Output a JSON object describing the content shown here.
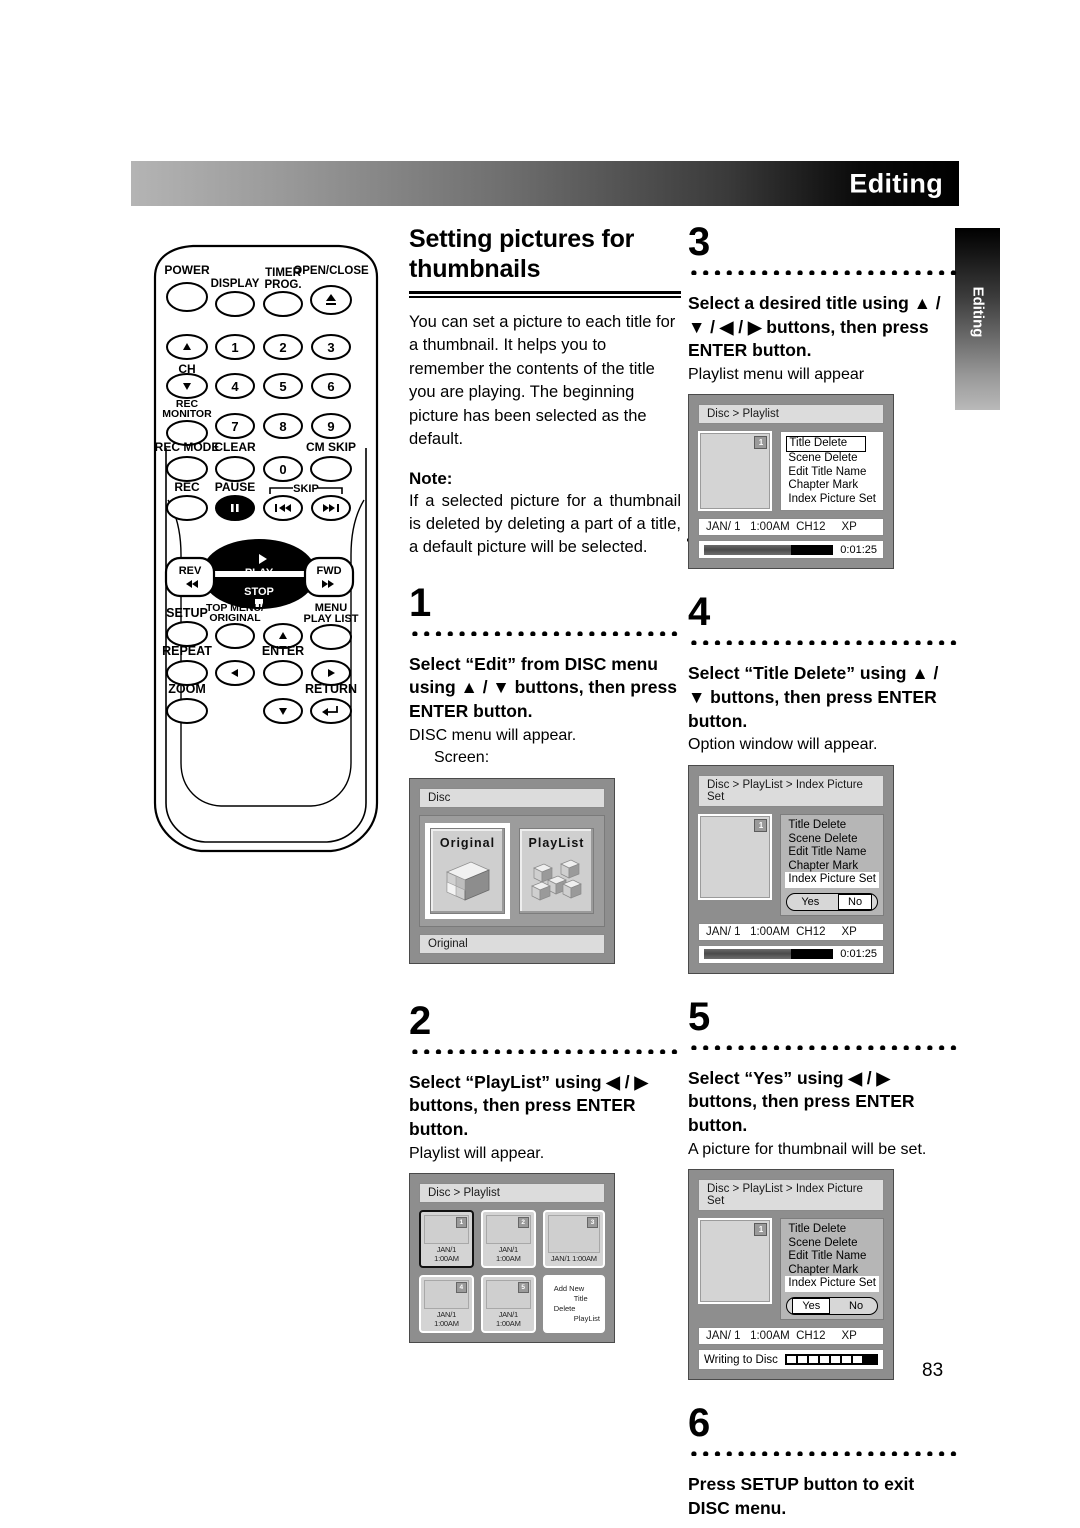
{
  "header": {
    "title": "Editing"
  },
  "side_tab": {
    "label": "Editing"
  },
  "page_number": "83",
  "left_column": {
    "section_title": "Setting pictures for thumbnails",
    "intro": "You can set a picture to each title for a thumbnail. It helps you to remember the contents of the title you are playing. The beginning picture has been selected as the default.",
    "note_label": "Note:",
    "note_body": "If a selected picture for a thumbnail is deleted by deleting a part of a title, a default picture will be selected.",
    "step1": {
      "number": "1",
      "heading": "Select “Edit” from DISC menu using ▲ / ▼ buttons, then press ENTER button.",
      "sub": "DISC menu will appear.",
      "sub2": "Screen:",
      "screen": {
        "crumb": "Disc",
        "card_original_label": "Original",
        "card_playlist_label": "PlayList",
        "status": "Original"
      }
    },
    "step2": {
      "number": "2",
      "heading": "Select “PlayList” using ◀ / ▶ buttons, then press ENTER button.",
      "sub": "Playlist will appear.",
      "screen": {
        "crumb": "Disc > Playlist",
        "cells": [
          {
            "num": "1",
            "stamp": "JAN/1   1:00AM",
            "selected": true
          },
          {
            "num": "2",
            "stamp": "JAN/1   1:00AM",
            "selected": false
          },
          {
            "num": "3",
            "stamp": "JAN/1   1:00AM",
            "selected": false
          },
          {
            "num": "4",
            "stamp": "JAN/1   1:00AM",
            "selected": false
          },
          {
            "num": "5",
            "stamp": "JAN/1   1:00AM",
            "selected": false
          }
        ],
        "actions": [
          "Add  New",
          "Title",
          "Delete",
          "PlayList"
        ]
      }
    }
  },
  "right_column": {
    "step3": {
      "number": "3",
      "heading": "Select a desired title using ▲ / ▼ / ◀ / ▶ buttons, then press ENTER button.",
      "sub": "Playlist menu will appear",
      "screen": {
        "crumb": "Disc > Playlist",
        "thumb_badge": "1",
        "menu": [
          "Title Delete",
          "Scene Delete",
          "Edit Title Name",
          "Chapter Mark",
          "Index Picture Set"
        ],
        "selected_menu": "Title Delete",
        "info": "JAN/ 1   1:00AM  CH12     XP",
        "time": "0:01:25"
      }
    },
    "step4": {
      "number": "4",
      "heading": "Select “Title Delete” using ▲ / ▼ buttons, then press ENTER button.",
      "sub": "Option window will appear.",
      "screen": {
        "crumb": "Disc > PlayList > Index Picture Set",
        "thumb_badge": "1",
        "menu": [
          "Title Delete",
          "Scene Delete",
          "Edit Title Name",
          "Chapter Mark",
          "Index Picture Set"
        ],
        "selected_menu": "Index Picture Set",
        "yes_label": "Yes",
        "no_label": "No",
        "yesno_selected": "No",
        "info": "JAN/ 1   1:00AM  CH12     XP",
        "time": "0:01:25"
      }
    },
    "step5": {
      "number": "5",
      "heading": "Select “Yes” using ◀ / ▶ buttons, then press ENTER button.",
      "sub": "A picture for thumbnail will be set.",
      "screen": {
        "crumb": "Disc > PlayList > Index Picture Set",
        "thumb_badge": "1",
        "menu": [
          "Title Delete",
          "Scene Delete",
          "Edit Title Name",
          "Chapter Mark",
          "Index Picture Set"
        ],
        "selected_menu": "Index Picture Set",
        "yes_label": "Yes",
        "no_label": "No",
        "yesno_selected": "Yes",
        "info": "JAN/ 1   1:00AM  CH12     XP",
        "writing_label": "Writing to Disc"
      }
    },
    "step6": {
      "number": "6",
      "heading": "Press SETUP button to exit DISC menu."
    }
  },
  "remote": {
    "buttons": [
      "POWER",
      "DISPLAY",
      "TIMER PROG.",
      "OPEN/CLOSE",
      "CH",
      "REC MONITOR",
      "REC MODE",
      "CLEAR",
      "CM SKIP",
      "REC",
      "PAUSE",
      "SKIP",
      "REV",
      "PLAY",
      "STOP",
      "FWD",
      "SETUP",
      "TOP MENU/ ORIGINAL",
      "MENU PLAY LIST",
      "REPEAT",
      "ENTER",
      "ZOOM",
      "RETURN"
    ],
    "numbers": [
      "1",
      "2",
      "3",
      "4",
      "5",
      "6",
      "7",
      "8",
      "9",
      "0"
    ],
    "labels": {
      "power": "POWER",
      "display": "DISPLAY",
      "timer_prog_l1": "TIMER",
      "timer_prog_l2": "PROG.",
      "open_close": "OPEN/CLOSE",
      "ch": "CH",
      "rec_monitor_l1": "REC",
      "rec_monitor_l2": "MONITOR",
      "rec_mode": "REC MODE",
      "clear": "CLEAR",
      "cm_skip": "CM SKIP",
      "rec": "REC",
      "pause": "PAUSE",
      "skip": "SKIP",
      "rev": "REV",
      "play": "PLAY",
      "stop": "STOP",
      "fwd": "FWD",
      "setup": "SETUP",
      "top_menu_l1": "TOP MENU/",
      "top_menu_l2": "ORIGINAL",
      "menu_play_l1": "MENU",
      "menu_play_l2": "PLAY LIST",
      "repeat": "REPEAT",
      "enter": "ENTER",
      "zoom": "ZOOM",
      "return": "RETURN"
    }
  }
}
